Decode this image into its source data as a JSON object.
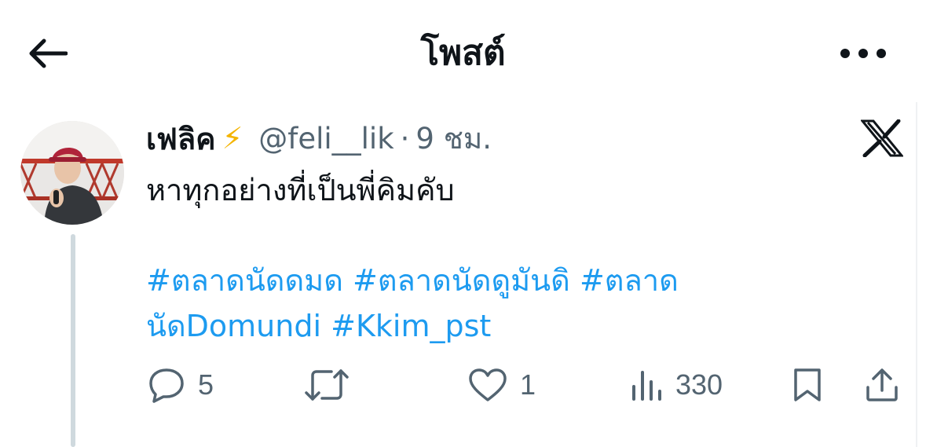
{
  "header": {
    "title": "โพสต์",
    "back_icon": "arrow-left-icon",
    "more_icon": "more-dots-icon"
  },
  "post": {
    "display_name": "เฟลิค",
    "name_emoji": "⚡",
    "handle": "@feli__lik",
    "separator": "·",
    "time": "9 ชม.",
    "source_icon": "x-logo-icon",
    "text": "หาทุกอย่างที่เป็นพี่คิมคับ",
    "hashtags": [
      "#ตลาดนัดดมด",
      "#ตลาดนัดดูมันดิ",
      "#ตลาดนัดDomundi",
      "#Kkim_pst"
    ]
  },
  "actions": {
    "reply_count": "5",
    "repost_count": "",
    "like_count": "1",
    "views_count": "330"
  },
  "colors": {
    "text": "#0f1419",
    "secondary": "#536471",
    "link": "#1d9bf0",
    "thread_line": "#cfd9de",
    "bolt": "#f4b400"
  }
}
